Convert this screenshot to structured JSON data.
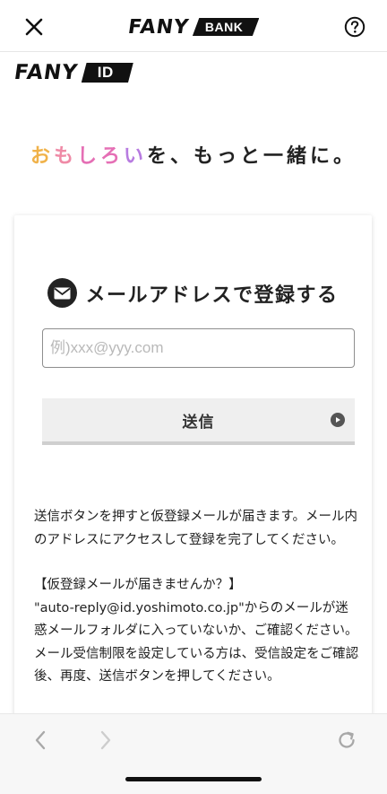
{
  "topbar": {
    "logo_word": "FANY",
    "logo_tag": "BANK",
    "close_icon": "close-icon",
    "help_icon": "help-icon"
  },
  "id_logo": {
    "logo_word": "FANY",
    "logo_tag": "ID"
  },
  "tagline": {
    "part1": "お",
    "part2": "も",
    "part3": "しろ",
    "part4": "い",
    "rest": "を、もっと一緒に。"
  },
  "card": {
    "icon": "mail-icon",
    "title": "メールアドレスで登録する",
    "email_input": {
      "value": "",
      "placeholder": "例)xxx@yyy.com"
    },
    "send_label": "送信",
    "send_icon": "play-circle-icon",
    "description": {
      "line1": "送信ボタンを押すと仮登録メールが届きます。メール内のアドレスにアクセスして登録を完了してください。",
      "line2": "【仮登録メールが届きませんか？】",
      "line3": "\"auto-reply@id.yoshimoto.co.jp\"からのメールが迷惑メールフォルダに入っていないか、ご確認ください。",
      "line4": "メール受信制限を設定している方は、受信設定をご確認後、再度、送信ボタンを押してください。"
    }
  },
  "toolbar": {
    "back_icon": "chevron-left-icon",
    "forward_icon": "chevron-right-icon",
    "reload_icon": "reload-icon"
  },
  "colors": {
    "tagline_o": "#f0b24a",
    "tagline_mo": "#ef8aa6",
    "tagline_shiro": "#e56fb5",
    "tagline_i": "#b77be0",
    "text": "#222222"
  }
}
